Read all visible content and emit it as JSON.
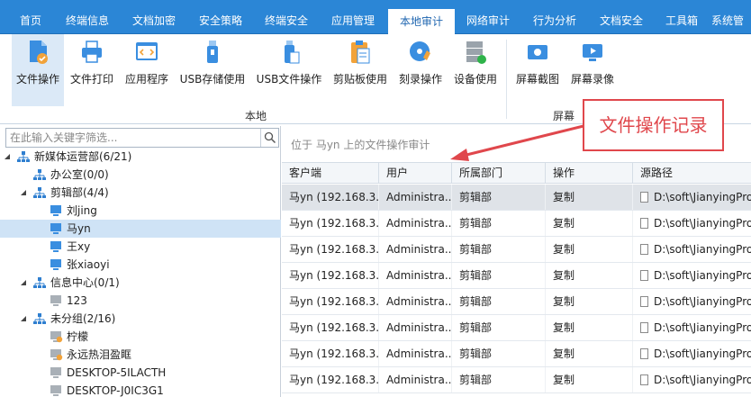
{
  "nav": {
    "tabs": [
      {
        "label": "首页"
      },
      {
        "label": "终端信息"
      },
      {
        "label": "文档加密"
      },
      {
        "label": "安全策略"
      },
      {
        "label": "终端安全"
      },
      {
        "label": "应用管理"
      },
      {
        "label": "本地审计",
        "active": true
      },
      {
        "label": "网络审计"
      },
      {
        "label": "行为分析"
      },
      {
        "label": "文档安全"
      },
      {
        "label": "工具箱"
      },
      {
        "label": "系统管"
      }
    ]
  },
  "ribbon": {
    "groups": [
      {
        "label": "本地",
        "items": [
          {
            "label": "文件操作",
            "icon": "file-operation-icon",
            "active": true
          },
          {
            "label": "文件打印",
            "icon": "printer-icon"
          },
          {
            "label": "应用程序",
            "icon": "application-icon"
          },
          {
            "label": "USB存储使用",
            "icon": "usb-storage-icon"
          },
          {
            "label": "USB文件操作",
            "icon": "usb-file-icon"
          },
          {
            "label": "剪贴板使用",
            "icon": "clipboard-icon"
          },
          {
            "label": "刻录操作",
            "icon": "disc-burn-icon"
          },
          {
            "label": "设备使用",
            "icon": "device-icon"
          }
        ]
      },
      {
        "label": "屏幕",
        "items": [
          {
            "label": "屏幕截图",
            "icon": "screenshot-icon"
          },
          {
            "label": "屏幕录像",
            "icon": "screen-record-icon"
          }
        ]
      }
    ]
  },
  "search": {
    "placeholder": "在此输入关键字筛选..."
  },
  "tree": [
    {
      "label": "新媒体运营部(6/21)",
      "type": "org",
      "level": 0,
      "expanded": true
    },
    {
      "label": "办公室(0/0)",
      "type": "org",
      "level": 1
    },
    {
      "label": "剪辑部(4/4)",
      "type": "org",
      "level": 1,
      "expanded": true
    },
    {
      "label": "刘jing",
      "type": "pc-online",
      "level": 2
    },
    {
      "label": "马yn",
      "type": "pc-online",
      "level": 2,
      "selected": true
    },
    {
      "label": "王xy",
      "type": "pc-online",
      "level": 2
    },
    {
      "label": "张xiaoyi",
      "type": "pc-online",
      "level": 2
    },
    {
      "label": "信息中心(0/1)",
      "type": "org",
      "level": 1,
      "expanded": true
    },
    {
      "label": "123",
      "type": "pc-offline",
      "level": 2
    },
    {
      "label": "未分组(2/16)",
      "type": "org",
      "level": 1,
      "expanded": true
    },
    {
      "label": "柠檬",
      "type": "pc-warn",
      "level": 2
    },
    {
      "label": "永远热泪盈眶",
      "type": "pc-warn",
      "level": 2
    },
    {
      "label": "DESKTOP-5ILACTH",
      "type": "pc-offline",
      "level": 2
    },
    {
      "label": "DESKTOP-J0IC3G1",
      "type": "pc-offline",
      "level": 2
    }
  ],
  "main": {
    "location": "位于 马yn 上的文件操作审计",
    "columns": [
      "客户端",
      "用户",
      "所属部门",
      "操作",
      "源路径"
    ],
    "rows": [
      [
        "马yn (192.168.3...",
        "Administra...",
        "剪辑部",
        "复制",
        "D:\\soft\\JianyingPro"
      ],
      [
        "马yn (192.168.3...",
        "Administra...",
        "剪辑部",
        "复制",
        "D:\\soft\\JianyingPro"
      ],
      [
        "马yn (192.168.3...",
        "Administra...",
        "剪辑部",
        "复制",
        "D:\\soft\\JianyingPro"
      ],
      [
        "马yn (192.168.3...",
        "Administra...",
        "剪辑部",
        "复制",
        "D:\\soft\\JianyingPro"
      ],
      [
        "马yn (192.168.3...",
        "Administra...",
        "剪辑部",
        "复制",
        "D:\\soft\\JianyingPro"
      ],
      [
        "马yn (192.168.3...",
        "Administra...",
        "剪辑部",
        "复制",
        "D:\\soft\\JianyingPro"
      ],
      [
        "马yn (192.168.3...",
        "Administra...",
        "剪辑部",
        "复制",
        "D:\\soft\\JianyingPro"
      ],
      [
        "马yn (192.168.3...",
        "Administra...",
        "剪辑部",
        "复制",
        "D:\\soft\\JianyingPro"
      ]
    ]
  },
  "callout": {
    "text": "文件操作记录",
    "color": "#e0474c"
  },
  "colors": {
    "nav_bg": "#2b86d6",
    "active_tab_text": "#1f66b0",
    "selected_row": "#dfe3e8",
    "tree_selected": "#cfe3f6"
  }
}
